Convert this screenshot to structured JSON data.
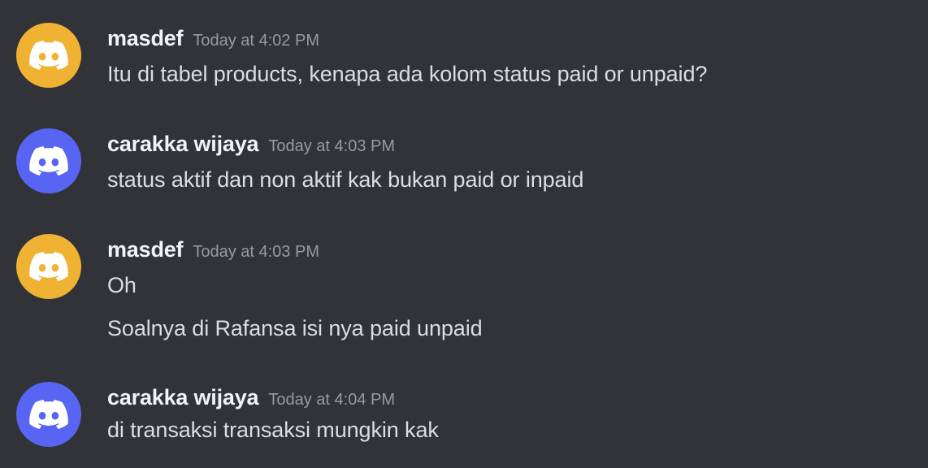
{
  "colors": {
    "background": "#313338",
    "avatar_orange": "#f0b232",
    "avatar_blurple": "#5865f2",
    "username": "#f2f3f5",
    "timestamp": "#949ba4",
    "message_text": "#dbdee1"
  },
  "messages": [
    {
      "author": "masdef",
      "avatar_icon": "discord-logo-icon",
      "avatar_color": "#f0b232",
      "timestamp": "Today at 4:02 PM",
      "lines": [
        "Itu di tabel products, kenapa ada kolom status paid or unpaid?"
      ]
    },
    {
      "author": "carakka wijaya",
      "avatar_icon": "discord-logo-icon",
      "avatar_color": "#5865f2",
      "timestamp": "Today at 4:03 PM",
      "lines": [
        "status aktif dan non aktif kak bukan paid or inpaid"
      ]
    },
    {
      "author": "masdef",
      "avatar_icon": "discord-logo-icon",
      "avatar_color": "#f0b232",
      "timestamp": "Today at 4:03 PM",
      "lines": [
        "Oh",
        "Soalnya di Rafansa isi nya paid unpaid"
      ]
    },
    {
      "author": "carakka wijaya",
      "avatar_icon": "discord-logo-icon",
      "avatar_color": "#5865f2",
      "timestamp": "Today at 4:04 PM",
      "lines": [
        "di transaksi transaksi mungkin kak"
      ]
    }
  ]
}
